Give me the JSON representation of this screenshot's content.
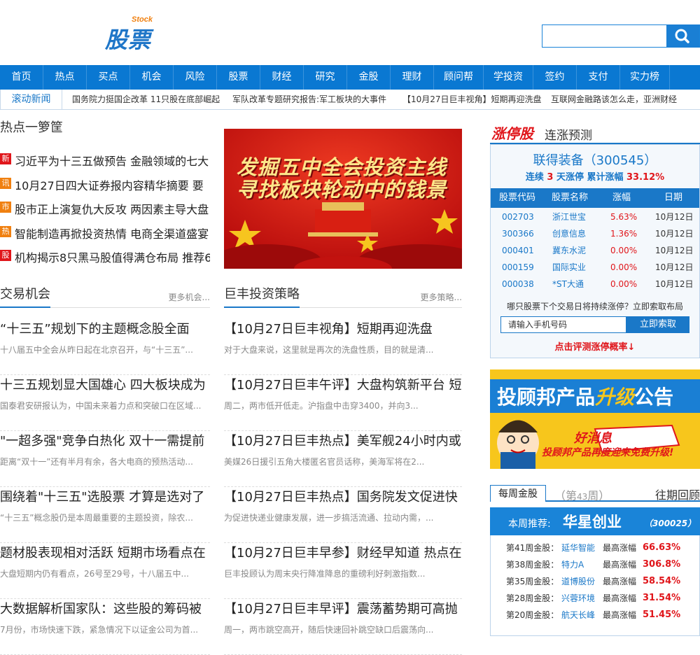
{
  "header": {
    "logo_en": "Stock",
    "logo_zh": "股票",
    "search_placeholder": ""
  },
  "nav": [
    {
      "label": "首页",
      "w": 62
    },
    {
      "label": "热点",
      "w": 62
    },
    {
      "label": "买点",
      "w": 62
    },
    {
      "label": "机会",
      "w": 62
    },
    {
      "label": "风险",
      "w": 62
    },
    {
      "label": "股票",
      "w": 62
    },
    {
      "label": "财经",
      "w": 62
    },
    {
      "label": "研究",
      "w": 62
    },
    {
      "label": "金股",
      "w": 62
    },
    {
      "label": "理财",
      "w": 62
    },
    {
      "label": "顾问帮",
      "w": 71
    },
    {
      "label": "学投资",
      "w": 71
    },
    {
      "label": "签约",
      "w": 62
    },
    {
      "label": "支付",
      "w": 62
    },
    {
      "label": "实力榜",
      "w": 71
    }
  ],
  "ticker": {
    "label": "滚动新闻",
    "items": [
      "国务院力挺国企改革 11只股在底部崛起",
      "军队改革专题研究报告:军工板块的大事件",
      "【10月27日巨丰视角】短期再迎洗盘",
      "互联网金融路该怎么走，亚洲财经"
    ]
  },
  "hot": {
    "title": "热点一箩筐",
    "items": [
      {
        "tag": "新",
        "color": "#e0161b",
        "text": "习近平为十三五做预告 金融领域的七大"
      },
      {
        "tag": "讯",
        "color": "#f08010",
        "text": "10月27日四大证券报内容精华摘要 要"
      },
      {
        "tag": "市",
        "color": "#f08010",
        "text": "股市正上演复仇大反攻 两因素主导大盘"
      },
      {
        "tag": "热",
        "color": "#f08010",
        "text": "智能制造再掀投资热情 电商全渠道盛宴"
      },
      {
        "tag": "股",
        "color": "#e0161b",
        "text": "机构揭示8只黑马股值得满仓布局 推荐6"
      }
    ]
  },
  "banner": {
    "line1": "发掘五中全会投资主线",
    "line2": "寻找板块轮动中的钱景"
  },
  "opportunities": {
    "title": "交易机会",
    "more": "更多机会...",
    "items": [
      {
        "h": "“十三五”规划下的主题概念股全面",
        "s": "十八届五中全会从昨日起在北京召开，与“十三五”..."
      },
      {
        "h": "十三五规划显大国雄心 四大板块成为",
        "s": "国泰君安研报认为，中国未来着力点和突破口在区域..."
      },
      {
        "h": "\"一超多强\"竞争白热化 双十一需提前",
        "s": "距离“双十一”还有半月有余，各大电商的预热活动..."
      },
      {
        "h": "围绕着\"十三五\"选股票 才算是选对了",
        "s": "“十三五”概念股仍是本周最重要的主题投资，除农..."
      },
      {
        "h": "题材股表现相对活跃 短期市场看点在",
        "s": "大盘短期内仍有看点，26号至29号，十八届五中..."
      },
      {
        "h": "大数据解析国家队：这些股的筹码被",
        "s": "7月份，市场快速下跌，紧急情况下以证金公司为首..."
      }
    ]
  },
  "strategy": {
    "title": "巨丰投资策略",
    "more": "更多策略...",
    "items": [
      {
        "h": "【10月27日巨丰视角】短期再迎洗盘",
        "s": "对于大盘来说，这里就是再次的洗盘性质，目的就是清..."
      },
      {
        "h": "【10月27日巨丰午评】大盘构筑新平台 短",
        "s": "周二，两市低开低走。沪指盘中击穿3400，并向3..."
      },
      {
        "h": "【10月27日巨丰热点】美军舰24小时内或",
        "s": "美媒26日援引五角大楼匿名官员话称，美海军将在2..."
      },
      {
        "h": "【10月27日巨丰热点】国务院发文促进快",
        "s": "为促进快递业健康发展，进一步搞活流通、拉动内需，..."
      },
      {
        "h": "【10月27日巨丰早参】财经早知道 热点在",
        "s": "巨丰投顾认为周末央行降准降息的重磅利好刺激指数..."
      },
      {
        "h": "【10月27日巨丰早评】震荡蓄势期可高抛",
        "s": "周一，两市跳空高开，随后快速回补跳空缺口后震荡向..."
      }
    ]
  },
  "limit_up": {
    "logo": "涨停股",
    "title": "连涨预测",
    "stock": "联得装备（300545）",
    "sub_a": "连续",
    "sub_days": "3",
    "sub_b": "天涨停 累计涨幅",
    "sub_pct": "33.12%",
    "headers": [
      "股票代码",
      "股票名称",
      "涨幅",
      "日期"
    ],
    "rows": [
      {
        "code": "002703",
        "name": "浙江世宝",
        "pct": "5.63%",
        "date": "10月12日"
      },
      {
        "code": "300366",
        "name": "创意信息",
        "pct": "1.36%",
        "date": "10月12日"
      },
      {
        "code": "000401",
        "name": "冀东水泥",
        "pct": "0.00%",
        "date": "10月12日"
      },
      {
        "code": "000159",
        "name": "国际实业",
        "pct": "0.00%",
        "date": "10月12日"
      },
      {
        "code": "000038",
        "name": "*ST大通",
        "pct": "0.00%",
        "date": "10月12日"
      }
    ],
    "ask": "哪只股票下个交易日将持续涨停？立即索取布局",
    "phone_placeholder": "请输入手机号码",
    "submit": "立即索取",
    "link": "点击评测涨停概率↓"
  },
  "ad": {
    "title_a": "投顾邦产品",
    "title_b": "升级",
    "title_c": "公告",
    "bubble": "好消息",
    "line": "投顾邦产品再度迎来免费升级!"
  },
  "weekly": {
    "tab": "每周金股",
    "no_a": "（第",
    "no_n": "43",
    "no_b": "周）",
    "past": "往期回顾",
    "rec_label": "本周推荐:",
    "rec_name": "华星创业",
    "rec_code": "（300025）",
    "rows": [
      {
        "week": "第41周金股：",
        "stock": "延华智能",
        "gain_label": "最高涨幅",
        "gain": "66.63%"
      },
      {
        "week": "第38周金股：",
        "stock": "特力A",
        "gain_label": "最高涨幅",
        "gain": "306.8%"
      },
      {
        "week": "第35周金股：",
        "stock": "道博股份",
        "gain_label": "最高涨幅",
        "gain": "58.54%"
      },
      {
        "week": "第28周金股：",
        "stock": "兴蓉环境",
        "gain_label": "最高涨幅",
        "gain": "31.54%"
      },
      {
        "week": "第20周金股：",
        "stock": "航天长峰",
        "gain_label": "最高涨幅",
        "gain": "51.45%"
      }
    ]
  }
}
